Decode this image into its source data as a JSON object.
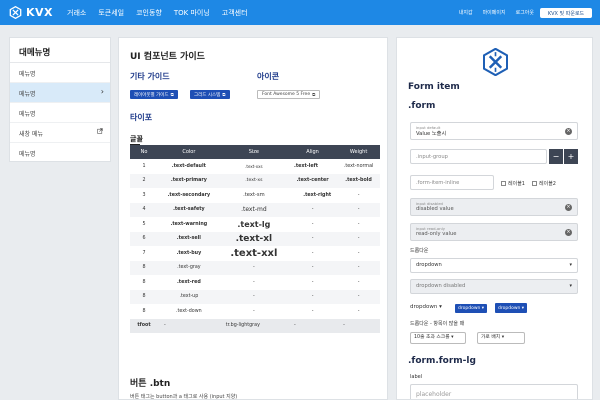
{
  "colors": {
    "header": "#1e88e5",
    "brand_blue": "#1e4fb5",
    "table_head": "#3d4554",
    "active_side": "#d8eaf9"
  },
  "header": {
    "logo": "KVX",
    "nav": [
      "거래소",
      "토큰세일",
      "코인동향",
      "TOK 마이닝",
      "고객센터"
    ],
    "util": [
      "내지갑",
      "마이페이지",
      "로그아웃"
    ],
    "user_button": "KVX 및 따운로드"
  },
  "sidebar": {
    "title": "대메뉴명",
    "items": [
      {
        "label": "메뉴명"
      },
      {
        "label": "메뉴명",
        "active": true,
        "icon": "chevron-right-icon"
      },
      {
        "label": "메뉴명"
      },
      {
        "label": "새창 메뉴",
        "icon": "external-link-icon"
      },
      {
        "label": "메뉴명"
      }
    ]
  },
  "main": {
    "title": "UI 컴포넌트 가이드",
    "etc_title": "기타 가이드",
    "etc_buttons": [
      "레이아웃별 가이드",
      "그리드 시스템"
    ],
    "icon_title": "아이콘",
    "icon_button": "Font Awesome 5 Free",
    "typo_title": "타이포",
    "font_title": "글꼴",
    "table": {
      "headers": [
        "No",
        "Color",
        "Size",
        "Align",
        "Weight"
      ],
      "rows": [
        [
          "1",
          ".text-default",
          ".text-xxs",
          ".text-left",
          ".text-normal"
        ],
        [
          "2",
          ".text-primary",
          ".text-xs",
          ".text-center",
          ".text-bold"
        ],
        [
          "3",
          ".text-secondary",
          ".text-sm",
          ".text-right",
          "-"
        ],
        [
          "4",
          ".text-safety",
          ".text-md",
          "-",
          "-"
        ],
        [
          "5",
          ".text-warning",
          ".text-lg",
          "-",
          "-"
        ],
        [
          "6",
          ".text-sell",
          ".text-xl",
          "-",
          "-"
        ],
        [
          "7",
          ".text-buy",
          ".text-xxl",
          "-",
          "-"
        ],
        [
          "8",
          ".text-gray",
          "-",
          "-",
          "-"
        ],
        [
          "8",
          ".text-red",
          "-",
          "-",
          "-"
        ],
        [
          "8",
          ".text-up",
          "-",
          "-",
          "-"
        ],
        [
          "8",
          ".text-down",
          "-",
          "-",
          "-"
        ]
      ],
      "foot": [
        "tfoot",
        "-",
        "tr.bg-lightgray",
        "-",
        "-"
      ]
    },
    "btn_title": "버튼 .btn",
    "btn_desc": "버튼 태그는 button과 a 태그로 사용 (input 지양)"
  },
  "form": {
    "title": "Form item",
    "form_class": ".form",
    "input_default": {
      "label": "input default",
      "value": "Value 노출시"
    },
    "input_group": {
      "placeholder": ".input-group"
    },
    "input_inline": {
      "placeholder": ".form-item-inline",
      "checks": [
        "레이블1",
        "레이블2"
      ]
    },
    "input_disabled": {
      "label": "input disabled",
      "value": "disabled value"
    },
    "input_readonly": {
      "label": "input read-only",
      "value": "read-only value"
    },
    "dropdown_label": "드롭다운",
    "dropdown": "dropdown",
    "dropdown_disabled": "dropdown disabled",
    "dropdown_plain": "dropdown",
    "dropdown_blue": [
      "dropdown",
      "dropdown"
    ],
    "inline_label": "드롭다운 - 항목이 많을 때",
    "inline_selects": [
      "10줄 초과 스크롤",
      "가로 배치"
    ],
    "form_lg": ".form.form-lg",
    "lg_label": "label",
    "lg_placeholder": "placeholder"
  }
}
